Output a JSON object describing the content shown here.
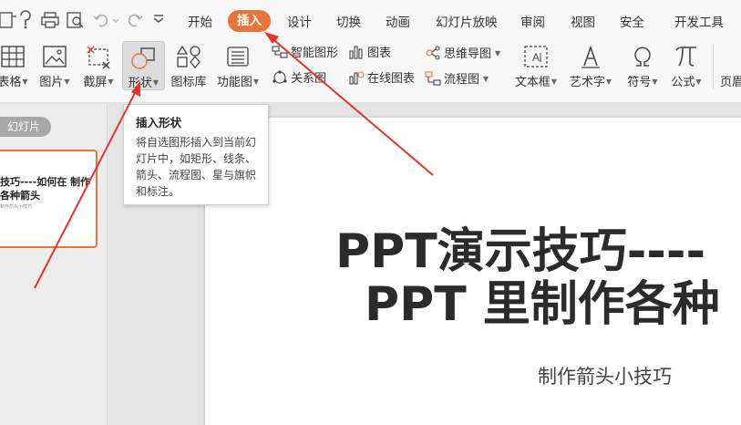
{
  "menubar": {
    "tabs": [
      {
        "label": "开始"
      },
      {
        "label": "插入"
      },
      {
        "label": "设计"
      },
      {
        "label": "切换"
      },
      {
        "label": "动画"
      },
      {
        "label": "幻灯片放映"
      },
      {
        "label": "审阅"
      },
      {
        "label": "视图"
      },
      {
        "label": "安全"
      },
      {
        "label": "开发工具"
      }
    ],
    "active_color": "#e8743b"
  },
  "ribbon": {
    "table": "表格",
    "picture": "图片",
    "screenshot": "截屏",
    "shapes": "形状",
    "icon_library": "图标库",
    "function_chart": "功能图",
    "smart_art": "智能图形",
    "chart": "图表",
    "relation_chart": "关系图",
    "online_chart": "在线图表",
    "mind_map": "思维导图",
    "flow_chart": "流程图",
    "textbox": "文本框",
    "wordart": "艺术字",
    "symbol": "符号",
    "formula": "公式",
    "header_footer": "页眉"
  },
  "tooltip": {
    "title": "插入形状",
    "body": "将自选图形插入到当前幻灯片中，如矩形、线条、箭头、流程图、星与旗帜和标注。"
  },
  "slide_panel": {
    "label": "幻灯片",
    "thumbnail": {
      "title": "技巧----如何在 制作各种箭头",
      "subtitle": "制作箭头小技巧"
    }
  },
  "slide": {
    "title_line1": "PPT演示技巧----",
    "title_line2": "PPT 里制作各种",
    "subtitle": "制作箭头小技巧"
  },
  "annotation_color": "#e8332a"
}
